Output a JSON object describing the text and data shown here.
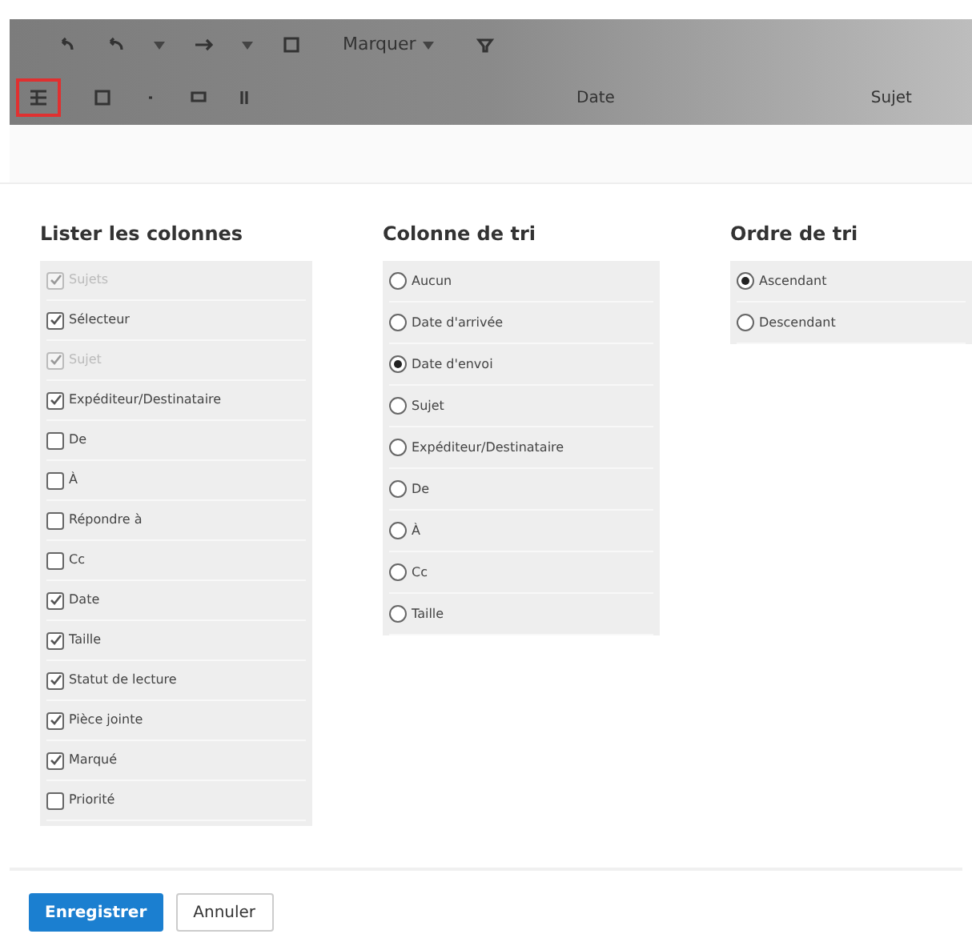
{
  "toolbar": {
    "mark_menu": "Marquer",
    "column_headers": [
      "Date",
      "Sujet"
    ],
    "highlighted_button": true
  },
  "columns_list": {
    "title": "Lister les colonnes",
    "items": [
      {
        "label": "Sujets",
        "checked": true,
        "disabled": true
      },
      {
        "label": "Sélecteur",
        "checked": true,
        "disabled": false
      },
      {
        "label": "Sujet",
        "checked": true,
        "disabled": true
      },
      {
        "label": "Expéditeur/Destinataire",
        "checked": true,
        "disabled": false
      },
      {
        "label": "De",
        "checked": false,
        "disabled": false
      },
      {
        "label": "À",
        "checked": false,
        "disabled": false
      },
      {
        "label": "Répondre à",
        "checked": false,
        "disabled": false
      },
      {
        "label": "Cc",
        "checked": false,
        "disabled": false
      },
      {
        "label": "Date",
        "checked": true,
        "disabled": false
      },
      {
        "label": "Taille",
        "checked": true,
        "disabled": false
      },
      {
        "label": "Statut de lecture",
        "checked": true,
        "disabled": false
      },
      {
        "label": "Pièce jointe",
        "checked": true,
        "disabled": false
      },
      {
        "label": "Marqué",
        "checked": true,
        "disabled": false
      },
      {
        "label": "Priorité",
        "checked": false,
        "disabled": false
      }
    ]
  },
  "sort_column": {
    "title": "Colonne de tri",
    "items": [
      {
        "label": "Aucun",
        "selected": false
      },
      {
        "label": "Date d'arrivée",
        "selected": false
      },
      {
        "label": "Date d'envoi",
        "selected": true
      },
      {
        "label": "Sujet",
        "selected": false
      },
      {
        "label": "Expéditeur/Destinataire",
        "selected": false
      },
      {
        "label": "De",
        "selected": false
      },
      {
        "label": "À",
        "selected": false
      },
      {
        "label": "Cc",
        "selected": false
      },
      {
        "label": "Taille",
        "selected": false
      }
    ]
  },
  "sort_order": {
    "title": "Ordre de tri",
    "items": [
      {
        "label": "Ascendant",
        "selected": true
      },
      {
        "label": "Descendant",
        "selected": false
      }
    ]
  },
  "buttons": [
    {
      "label": "Enregistrer",
      "kind": "primary"
    },
    {
      "label": "Annuler",
      "kind": "secondary"
    }
  ]
}
